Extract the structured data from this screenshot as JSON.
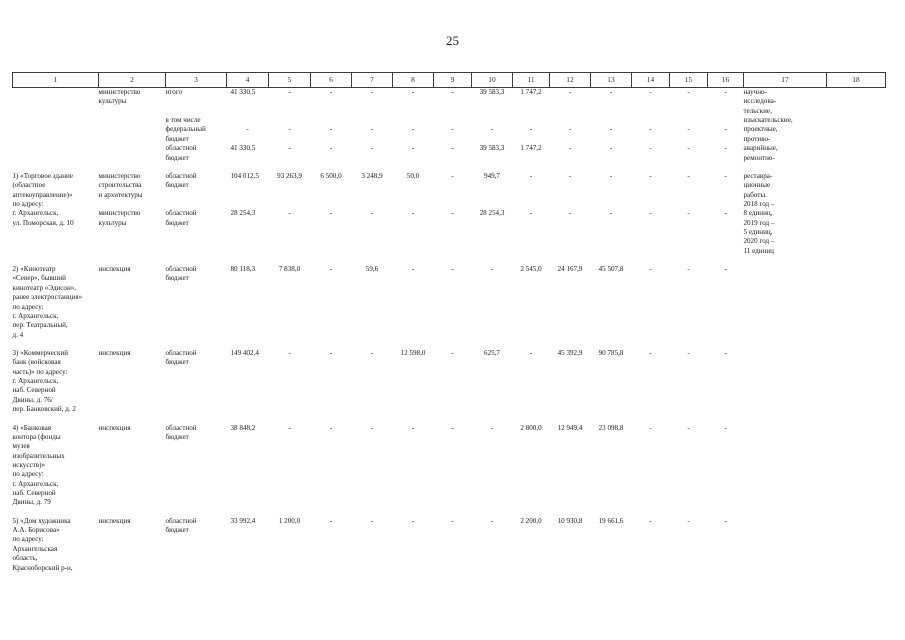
{
  "page": {
    "number": "25"
  },
  "table": {
    "column_headers": [
      "1",
      "2",
      "3",
      "4",
      "5",
      "6",
      "7",
      "8",
      "9",
      "10",
      "11",
      "12",
      "13",
      "14",
      "15",
      "16",
      "17",
      "18"
    ],
    "dash": "-",
    "groups": [
      {
        "name": "continuation-group",
        "subject_lines": [],
        "rows": [
          {
            "executor_lines": [
              "министерство",
              "культуры"
            ],
            "source_lines": [
              "итого"
            ],
            "values": [
              "41 330,5",
              "-",
              "-",
              "-",
              "-",
              "-",
              "39 583,3",
              "1 747,2",
              "-",
              "-",
              "-",
              "-",
              "-"
            ],
            "note_lines": [
              "научно-",
              "исследова-",
              "тельские,"
            ],
            "col18": ""
          },
          {
            "executor_lines": [],
            "source_lines": [
              "в том числе"
            ],
            "values": [
              "",
              "",
              "",
              "",
              "",
              "",
              "",
              "",
              "",
              "",
              "",
              "",
              ""
            ],
            "note_lines": [
              "изыскательские,"
            ],
            "col18": ""
          },
          {
            "executor_lines": [],
            "source_lines": [
              "федеральный",
              "бюджет"
            ],
            "values": [
              "-",
              "-",
              "-",
              "-",
              "-",
              "-",
              "-",
              "-",
              "-",
              "-",
              "-",
              "-",
              "-"
            ],
            "note_lines": [
              "проектные,",
              "противо-"
            ],
            "col18": ""
          },
          {
            "executor_lines": [],
            "source_lines": [
              "областной",
              "бюджет"
            ],
            "values": [
              "41 330,5",
              "-",
              "-",
              "-",
              "-",
              "-",
              "39 583,3",
              "1 747,2",
              "-",
              "-",
              "-",
              "-",
              "-"
            ],
            "note_lines": [
              "аварийные,",
              "ремонтно-"
            ],
            "col18": ""
          }
        ]
      },
      {
        "name": "item-1",
        "subject_lines": [
          "1) «Торговое здание",
          "(областное",
          "аптекоуправление)»",
          "по адресу:",
          " г. Архангельск,",
          "ул. Поморская, д. 10"
        ],
        "rows": [
          {
            "executor_lines": [
              "министерство",
              "строительства",
              "и архитектуры"
            ],
            "source_lines": [
              "областной",
              "бюджет"
            ],
            "values": [
              "104 012,5",
              "93 263,9",
              "6 500,0",
              "3 248,9",
              "50,0",
              "-",
              "949,7",
              "-",
              "-",
              "-",
              "-",
              "-",
              "-"
            ],
            "note_lines": [
              "реставра-",
              "ционные",
              "работы.",
              "2018 год –"
            ],
            "col18": ""
          },
          {
            "executor_lines": [
              "министерство",
              "культуры"
            ],
            "source_lines": [
              "областной",
              "бюджет"
            ],
            "values": [
              "28 254,3",
              "-",
              "-",
              "-",
              "-",
              "-",
              "28 254,3",
              "-",
              "-",
              "-",
              "-",
              "-",
              "-"
            ],
            "note_lines": [
              "8 единиц,",
              "2019 год –",
              "5 единиц,",
              "2020 год –",
              "11 единиц"
            ],
            "col18": ""
          }
        ]
      },
      {
        "name": "item-2",
        "subject_lines": [
          "2) «Кинотеатр",
          "«Север», бывший",
          "кинотеатр «Эдисон»,",
          "ранее электростанция»",
          "по адресу:",
          "г. Архангельск,",
          "пер. Театральный,",
          "д. 4"
        ],
        "rows": [
          {
            "executor_lines": [
              "инспекция"
            ],
            "source_lines": [
              "областной",
              "бюджет"
            ],
            "values": [
              "80 118,3",
              "7 838,0",
              "-",
              "59,6",
              "-",
              "-",
              "-",
              "2 545,0",
              "24 167,9",
              "45 507,8",
              "-",
              "-",
              "-"
            ],
            "note_lines": [],
            "col18": ""
          }
        ]
      },
      {
        "name": "item-3",
        "subject_lines": [
          "3) «Коммерческий",
          "банк (войсковая",
          "часть)» по адресу:",
          "г. Архангельск,",
          "наб. Северной",
          "Двины, д. 76/",
          "пер. Банковский, д. 2"
        ],
        "rows": [
          {
            "executor_lines": [
              "инспекция"
            ],
            "source_lines": [
              "областной",
              "бюджет"
            ],
            "values": [
              "149 402,4",
              "-",
              "-",
              "-",
              "12 598,0",
              "-",
              "625,7",
              "-",
              "45 392,9",
              "90 785,8",
              "-",
              "-",
              "-"
            ],
            "note_lines": [],
            "col18": ""
          }
        ]
      },
      {
        "name": "item-4",
        "subject_lines": [
          "4) «Банковая",
          "контора (фонды",
          "музея",
          "изобразительных",
          "искусств)»",
          "по адресу:",
          "г. Архангельск,",
          "наб. Северной",
          "Двины, д. 79"
        ],
        "rows": [
          {
            "executor_lines": [
              "инспекция"
            ],
            "source_lines": [
              "областной",
              "бюджет"
            ],
            "values": [
              "38 848,2",
              "-",
              "-",
              "-",
              "-",
              "-",
              "-",
              "2 800,0",
              "12 949,4",
              "23 098,8",
              "-",
              "-",
              "-"
            ],
            "note_lines": [],
            "col18": ""
          }
        ]
      },
      {
        "name": "item-5",
        "subject_lines": [
          "5) «Дом художника",
          "А.А. Борисова»",
          "по адресу:",
          "Архангельская",
          "область,",
          "Красноборский р-н,"
        ],
        "rows": [
          {
            "executor_lines": [
              "инспекция"
            ],
            "source_lines": [
              "областной",
              "бюджет"
            ],
            "values": [
              "33 992,4",
              "1 200,0",
              "-",
              "-",
              "-",
              "-",
              "-",
              "2 200,0",
              "10 930,8",
              "19 661,6",
              "-",
              "-",
              "-"
            ],
            "note_lines": [],
            "col18": ""
          }
        ]
      }
    ]
  }
}
